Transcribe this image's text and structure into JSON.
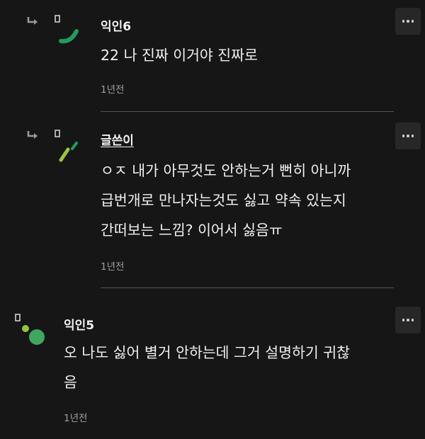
{
  "comments": [
    {
      "author": "익인6",
      "body": "22 나 진짜 이거야 진짜로",
      "time": "1년전",
      "is_op": false,
      "is_reply": true
    },
    {
      "author": "글쓴이",
      "body": "ㅇㅈ 내가 아무것도 안하는거 뻔히 아니까\n급번개로 만나자는것도 싫고 약속 있는지\n간떠보는 느낌? 이어서 싫음ㅠ",
      "time": "1년전",
      "is_op": true,
      "is_reply": true
    },
    {
      "author": "익인5",
      "body": "오 나도 싫어 별거 안하는데 그거 설명하기 귀찮\n음",
      "time": "1년전",
      "is_op": false,
      "is_reply": false
    }
  ],
  "icons": {
    "reply": "reply-arrow-icon",
    "more": "more-options-icon",
    "bookmark": "bookmark-icon"
  },
  "colors": {
    "background": "#161616",
    "avatar_green": "#1f9d5c",
    "avatar_lime": "#9bc53d",
    "avatar_green_light": "#3ea85f",
    "avatar_lime_light": "#93c63f",
    "divider": "#555555",
    "more_button_bg": "#272727"
  }
}
